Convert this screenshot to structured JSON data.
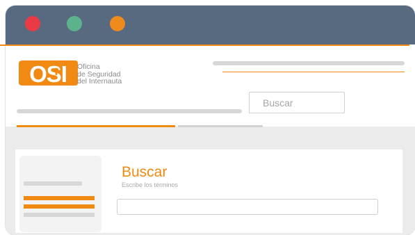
{
  "window": {
    "controls": [
      "close",
      "minimize",
      "maximize"
    ],
    "colors": {
      "titlebar": "#576a80",
      "close": "#ea3a46",
      "minimize": "#5cb38b",
      "maximize": "#ef8a1c",
      "accent": "#f08a12"
    }
  },
  "header": {
    "logo": {
      "mark": "OSI",
      "lines": [
        "Oficina",
        "de Seguridad",
        "del Internauta"
      ]
    },
    "search": {
      "placeholder": "Buscar"
    }
  },
  "main": {
    "heading": "Buscar",
    "subtext": "Escribe los términos",
    "input": {
      "value": ""
    }
  }
}
